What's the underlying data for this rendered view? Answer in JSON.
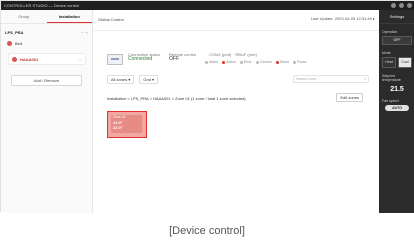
{
  "window": {
    "title": "CONTROLLER STUDIO — Device control"
  },
  "left_panel": {
    "tabs": [
      "Group",
      "Installation"
    ],
    "active_tab": "Installation",
    "project_name": "LPS_PRA",
    "project_actions": "⋯ +",
    "site_label": "Bed",
    "device_label": "HAAA001",
    "add_device_label": "Add / Remove"
  },
  "main": {
    "breadcrumb": "Global Control",
    "last_update": "Last Update: 2023-04-05 12:31:49 ▸",
    "device": {
      "connection_label": "Connection status",
      "connection_value": "Connected",
      "remote_label": "Remote control",
      "remote_value": "OFF",
      "ports": [
        "COM1 (port)",
        "RBUF (port)"
      ],
      "leds": [
        "Alarm",
        "Active",
        "Error",
        "Comms",
        "Stand",
        "Power"
      ]
    },
    "toolbar": {
      "filter_select": "All zones ▾",
      "view_select": "Grid ▾",
      "search_placeholder": "Search zone..."
    },
    "zone_section_title": "Installation > LPS_PRA > HAAA001 > Zone 01 (1 zone / total 1 zone selected)",
    "edit_button": "Edit zones",
    "zone": {
      "name": "Zone 01",
      "current_temp": "24.0°",
      "setpoint_temp": "22.0°",
      "mode": "Heat"
    }
  },
  "right_panel": {
    "header": "Settings",
    "power_label": "Operation",
    "power_value": "OFF",
    "mode_label": "Mode",
    "modes": [
      "Heat",
      "Cool"
    ],
    "setpoint_label": "Setpoint temperature",
    "setpoint_value": "21.5",
    "fan_label": "Fan speed",
    "fan_value": "AUTO"
  },
  "caption": "[Device control]"
}
